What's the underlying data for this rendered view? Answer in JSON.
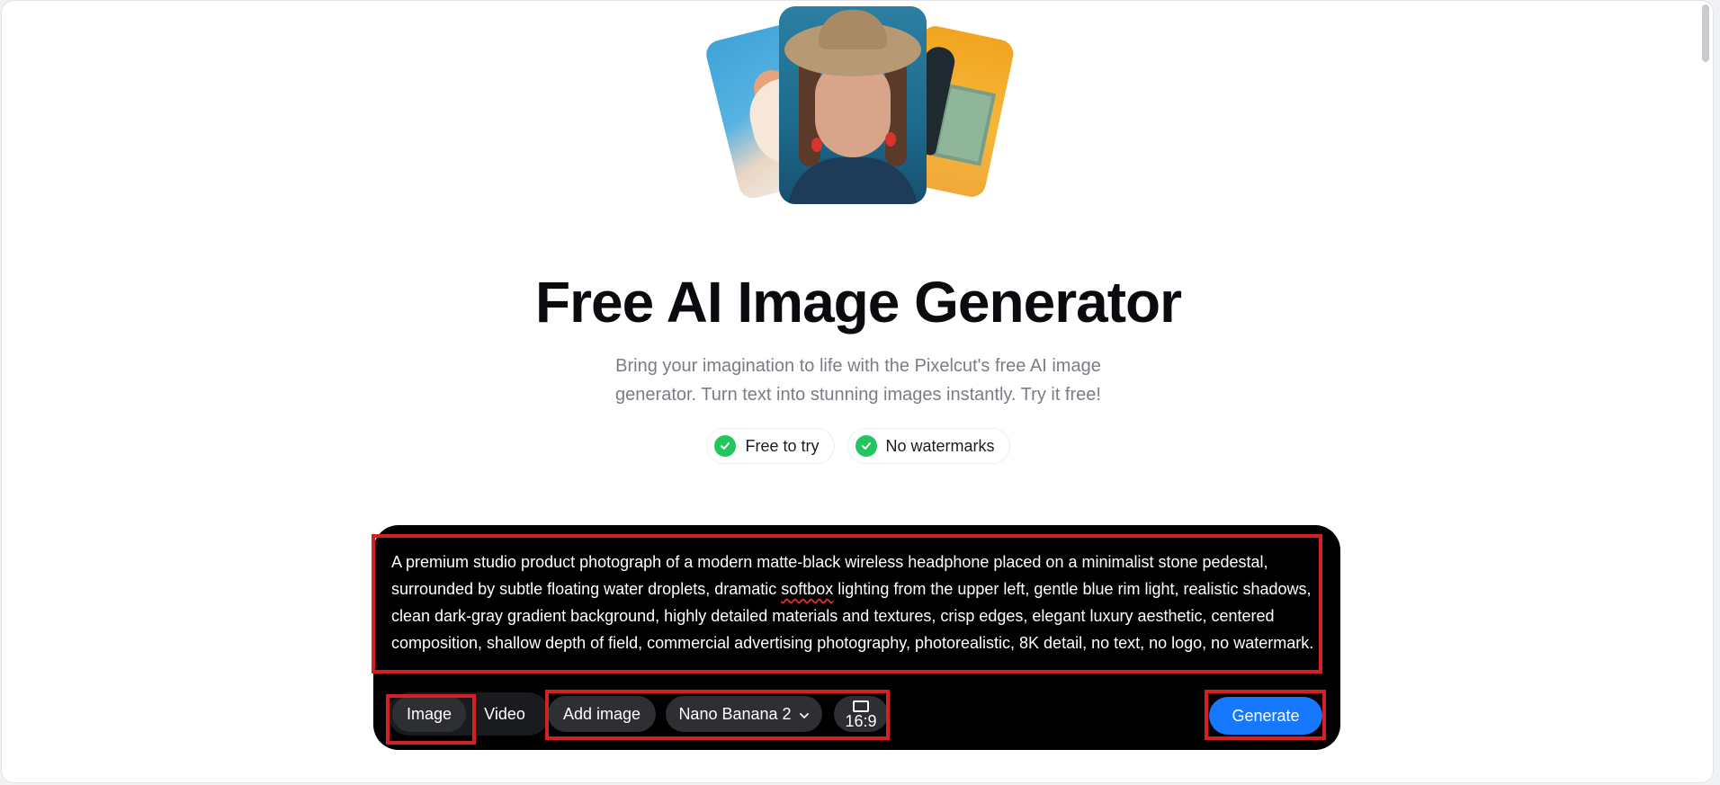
{
  "hero": {
    "title": "Free AI Image Generator",
    "subtitle_line1": "Bring your imagination to life with the Pixelcut's free AI image",
    "subtitle_line2": "generator. Turn text into stunning images instantly. Try it free!",
    "badges": [
      {
        "label": "Free to try",
        "icon": "check-circle-icon"
      },
      {
        "label": "No watermarks",
        "icon": "check-circle-icon"
      }
    ]
  },
  "prompt": {
    "text_before": "A premium studio product photograph of a modern matte-black wireless headphone placed on a minimalist stone pedestal, surrounded by subtle floating water droplets, dramatic ",
    "text_flagged": "softbox",
    "text_after": " lighting from the upper left, gentle blue rim light, realistic shadows, clean dark-gray gradient background, highly detailed materials and textures, crisp edges, elegant luxury aesthetic, centered composition, shallow depth of field, commercial advertising photography, photorealistic, 8K detail, no text, no logo, no watermark."
  },
  "toolbar": {
    "mode_tabs": [
      {
        "label": "Image",
        "selected": true
      },
      {
        "label": "Video",
        "selected": false
      }
    ],
    "add_image_label": "Add image",
    "model_label": "Nano Banana 2",
    "aspect_ratio": "16:9",
    "generate_label": "Generate"
  },
  "colors": {
    "accent": "#1677ff",
    "check": "#22c55e",
    "highlight": "#d42020",
    "panel": "#000000"
  }
}
